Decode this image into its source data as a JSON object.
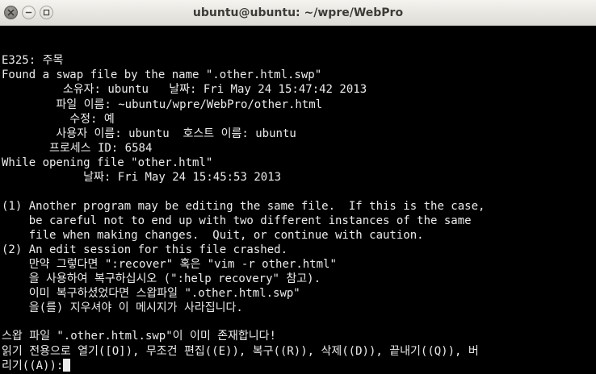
{
  "window": {
    "title": "ubuntu@ubuntu: ~/wpre/WebPro"
  },
  "terminal": {
    "lines": [
      "",
      "",
      "E325: 주목",
      "Found a swap file by the name \".other.html.swp\"",
      "         소유자: ubuntu   날짜: Fri May 24 15:47:42 2013",
      "        파일 이름: ~ubuntu/wpre/WebPro/other.html",
      "          수정: 예",
      "        사용자 이름: ubuntu  호스트 이름: ubuntu",
      "       프로세스 ID: 6584",
      "While opening file \"other.html\"",
      "            날짜: Fri May 24 15:45:53 2013",
      "",
      "(1) Another program may be editing the same file.  If this is the case,",
      "    be careful not to end up with two different instances of the same",
      "    file when making changes.  Quit, or continue with caution.",
      "(2) An edit session for this file crashed.",
      "    만약 그렇다면 \":recover\" 혹은 \"vim -r other.html\"",
      "    을 사용하여 복구하십시오 (\":help recovery\" 참고).",
      "    이미 복구하셨었다면 스왑파일 \".other.html.swp\"",
      "    을(를) 지우셔야 이 메시지가 사라집니다.",
      "",
      "스왑 파일 \".other.html.swp\"이 이미 존재합니다!",
      "읽기 전용으로 열기([O]), 무조건 편집((E)), 복구((R)), 삭제((D)), 끝내기((Q)), 버",
      "리기((A)):"
    ]
  }
}
